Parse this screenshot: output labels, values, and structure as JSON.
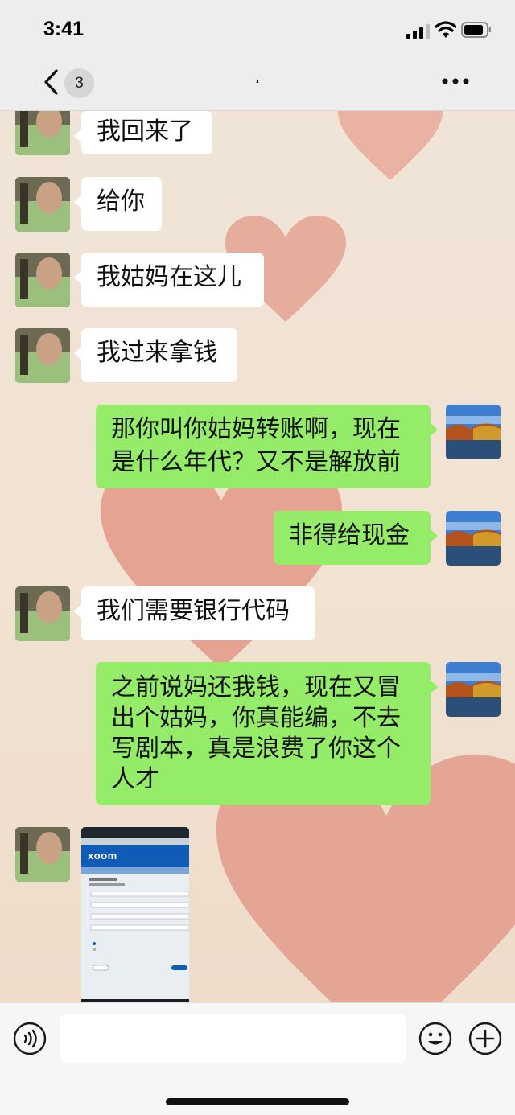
{
  "status": {
    "time": "3:41"
  },
  "nav": {
    "back_count": "3",
    "title": "."
  },
  "messages": [
    {
      "side": "in",
      "text": "我回来了"
    },
    {
      "side": "in",
      "text": "给你"
    },
    {
      "side": "in",
      "text": "我姑妈在这儿"
    },
    {
      "side": "in",
      "text": "我过来拿钱"
    },
    {
      "side": "out",
      "text": "那你叫你姑妈转账啊，现在是什么年代？又不是解放前"
    },
    {
      "side": "out",
      "text": "非得给现金"
    },
    {
      "side": "in",
      "text": "我们需要银行代码"
    },
    {
      "side": "out",
      "text": "之前说妈还我钱，现在又冒出个姑妈，你真能编，不去写剧本，真是浪费了你这个人才"
    },
    {
      "side": "in",
      "type": "image",
      "text": "xoom"
    }
  ],
  "input": {
    "placeholder": ""
  },
  "colors": {
    "outgoing_bubble": "#95ec69",
    "incoming_bubble": "#ffffff",
    "bar_bg": "#ededed"
  }
}
